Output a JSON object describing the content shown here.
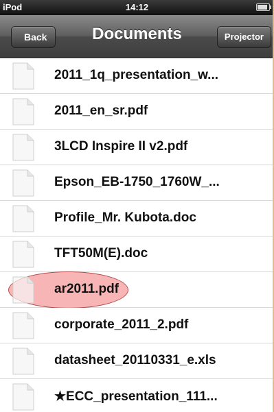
{
  "status": {
    "device": "iPod",
    "time": "14:12"
  },
  "nav": {
    "title": "Documents",
    "back_label": "Back",
    "projector_label": "Projector"
  },
  "files": [
    "2011_1q_presentation_w...",
    "2011_en_sr.pdf",
    "3LCD Inspire II  v2.pdf",
    "Epson_EB-1750_1760W_...",
    "Profile_Mr. Kubota.doc",
    "TFT50M(E).doc",
    "ar2011.pdf",
    "corporate_2011_2.pdf",
    "datasheet_20110331_e.xls",
    "★ECC_presentation_111..."
  ],
  "selected_file": "ar2011.pdf"
}
